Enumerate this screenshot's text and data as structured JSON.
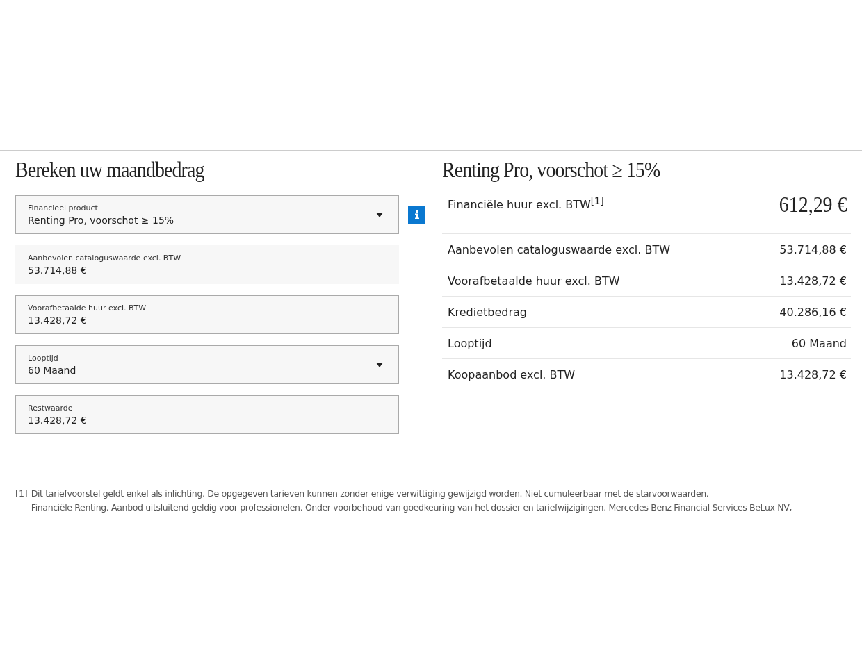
{
  "calculator": {
    "title": "Bereken uw maandbedrag",
    "fields": [
      {
        "kind": "select",
        "label": "Financieel product",
        "value": "Renting Pro, voorschot ≥ 15%",
        "info": true
      },
      {
        "kind": "readonly",
        "label": "Aanbevolen cataloguswaarde excl. BTW",
        "value": "53.714,88 €",
        "info": false
      },
      {
        "kind": "input",
        "label": "Voorafbetaalde huur excl. BTW",
        "value": "13.428,72 €",
        "info": false
      },
      {
        "kind": "select",
        "label": "Looptijd",
        "value": "60 Maand",
        "info": false
      },
      {
        "kind": "input",
        "label": "Restwaarde",
        "value": "13.428,72 €",
        "info": false
      }
    ]
  },
  "summary": {
    "title": "Renting Pro, voorschot ≥ 15%",
    "rows": [
      {
        "kind": "main",
        "label": "Financiële huur excl. BTW$^{[1]}$",
        "value": "612,29 €"
      },
      {
        "kind": "plain",
        "label": "Aanbevolen cataloguswaarde excl. BTW",
        "value": "53.714,88 €"
      },
      {
        "kind": "plain",
        "label": "Voorafbetaalde huur excl. BTW",
        "value": "13.428,72 €"
      },
      {
        "kind": "plain",
        "label": "Kredietbedrag",
        "value": "40.286,16 €"
      },
      {
        "kind": "plain",
        "label": "Looptijd",
        "value": "60 Maand"
      },
      {
        "kind": "plain",
        "label": "Koopaanbod excl. BTW",
        "value": "13.428,72 €"
      }
    ]
  },
  "footnote": {
    "marker": "[1]",
    "lines": [
      "Dit tariefvoorstel geldt enkel als inlichting. De opgegeven tarieven kunnen zonder enige verwittiging gewijzigd worden. Niet cumuleerbaar met de starvoorwaarden.",
      "Financiële Renting. Aanbod uitsluitend geldig voor professionelen. Onder voorbehoud van goedkeuring van het dossier en tariefwijzigingen. Mercedes-Benz Financial Services BeLux NV,"
    ]
  }
}
